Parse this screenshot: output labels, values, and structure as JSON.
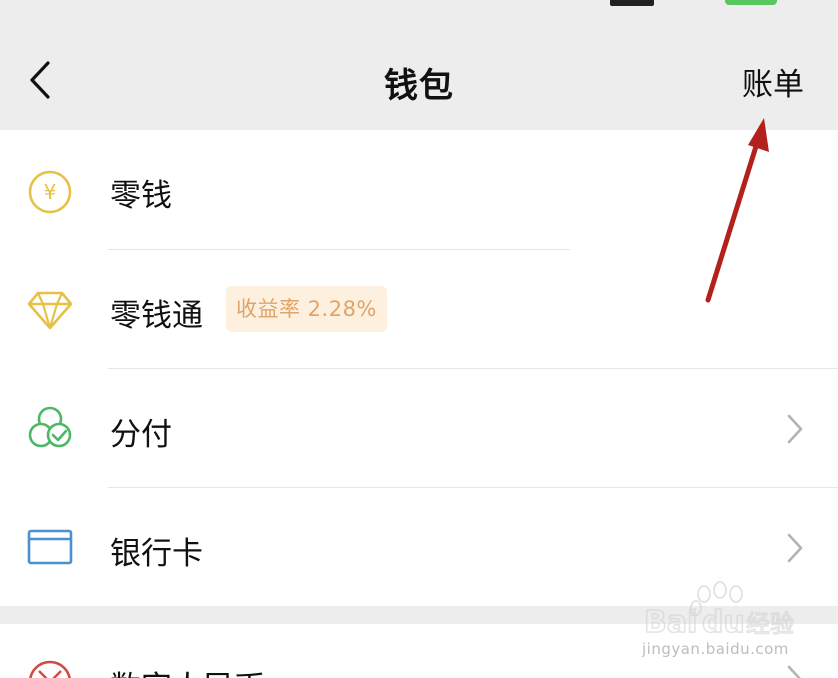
{
  "nav": {
    "title": "钱包",
    "bill_label": "账单"
  },
  "wallet_items": [
    {
      "label": "零钱",
      "icon": "yuan-coin-icon"
    },
    {
      "label": "零钱通",
      "icon": "diamond-icon",
      "badge": "收益率 2.28%"
    },
    {
      "label": "分付",
      "icon": "fenfu-icon"
    },
    {
      "label": "银行卡",
      "icon": "bank-card-icon"
    },
    {
      "label": "数字人民币",
      "icon": "digital-rmb-icon"
    }
  ],
  "colors": {
    "nav_background": "#ededed",
    "coin_yellow": "#e6c145",
    "fenfu_green": "#4cb865",
    "card_blue": "#4a8fd1",
    "digital_rmb_red": "#cf4a43",
    "badge_background": "#fdf0df",
    "badge_text": "#e0a46a",
    "annotation_arrow": "#b3211d"
  },
  "watermark": {
    "logo_icon": "baidu-jingyan-logo-icon",
    "url_text": "jingyan.baidu.com"
  }
}
